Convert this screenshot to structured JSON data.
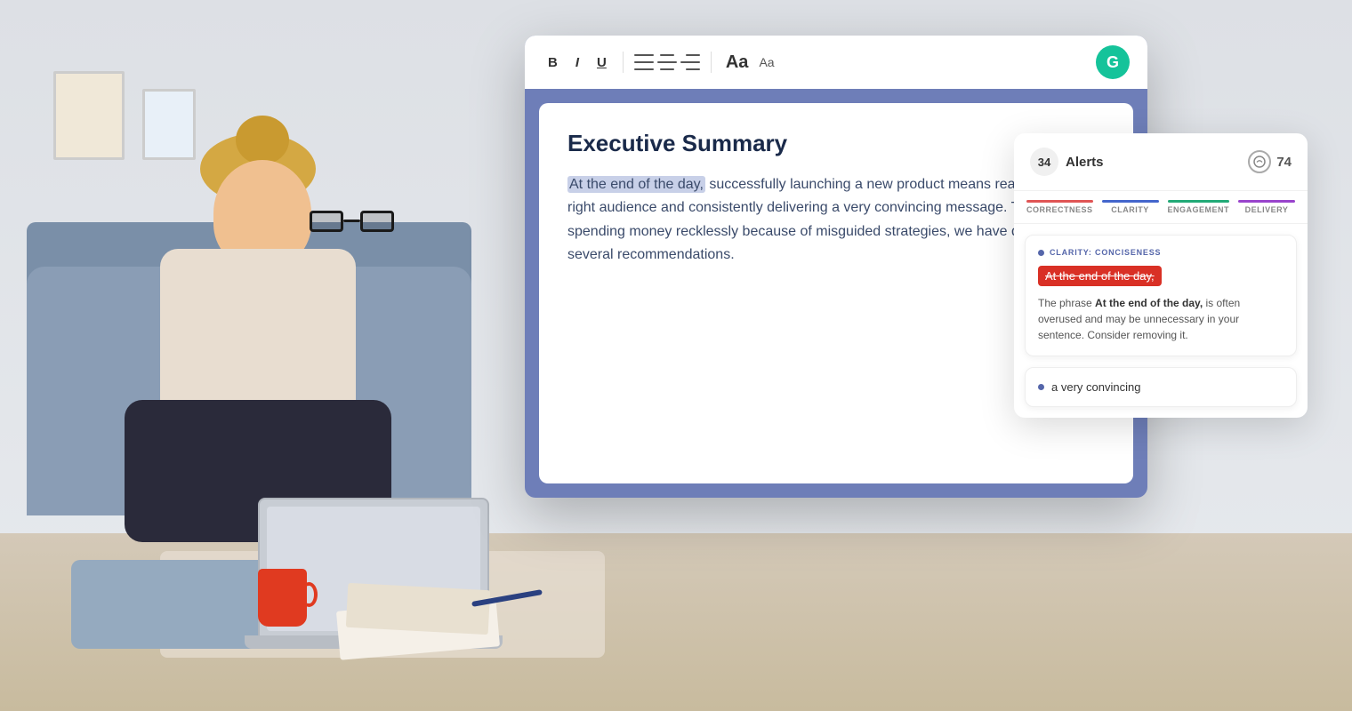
{
  "scene": {
    "background_color": "#e8eaed"
  },
  "toolbar": {
    "bold_label": "B",
    "italic_label": "I",
    "underline_label": "U",
    "font_large_label": "Aa",
    "font_small_label": "Aa",
    "grammarly_logo": "G"
  },
  "document": {
    "title": "Executive Summary",
    "paragraph": "At the end of the day, successfully launching a new product means reaching the right audience and consistently delivering a very convincing message. To avoid spending money recklessly because of misguided strategies, we have developed several recommendations."
  },
  "sidebar": {
    "alerts_count": "34",
    "alerts_label": "Alerts",
    "score": "74",
    "tabs": [
      {
        "label": "CORRECTNESS",
        "color": "#e05555"
      },
      {
        "label": "CLARITY",
        "color": "#4466cc"
      },
      {
        "label": "ENGAGEMENT",
        "color": "#22aa77"
      },
      {
        "label": "DELIVERY",
        "color": "#9944cc"
      }
    ],
    "primary_alert": {
      "type_label": "CLARITY: CONCISENESS",
      "highlighted_text": "At the end of the day,",
      "description": "The phrase At the end of the day, is often overused and may be unnecessary in your sentence. Consider removing it."
    },
    "secondary_alert": {
      "text": "a very convincing"
    }
  }
}
